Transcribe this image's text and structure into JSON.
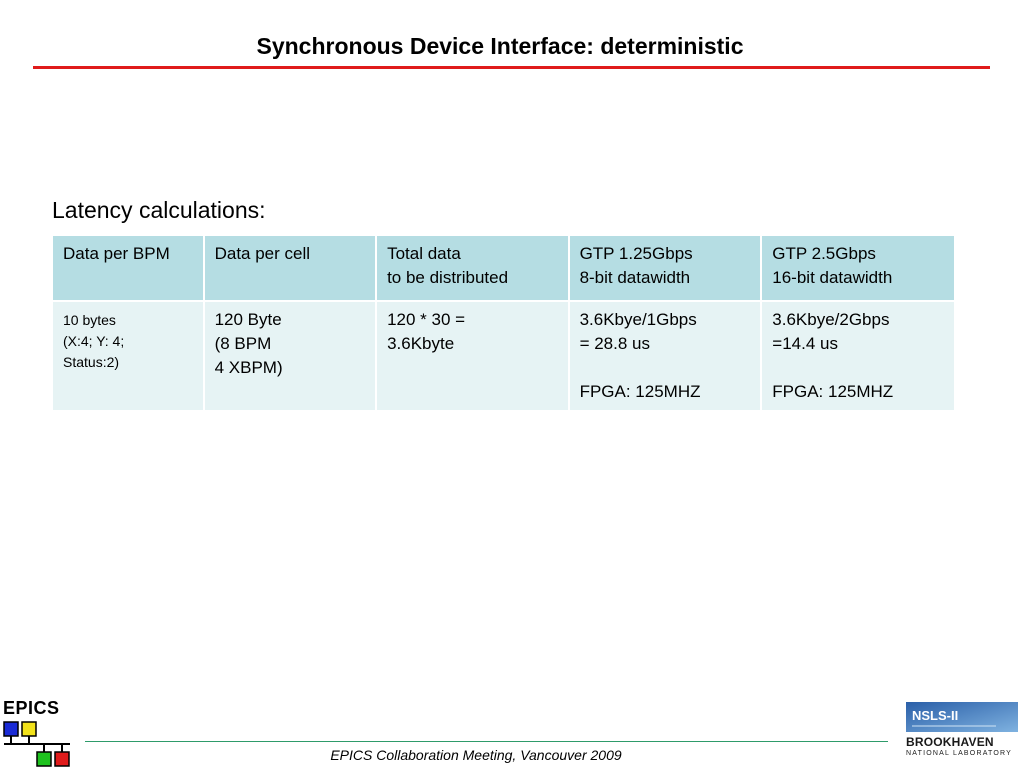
{
  "slide": {
    "title": "Synchronous Device Interface: deterministic",
    "subtitle": "Latency calculations:"
  },
  "table": {
    "headers": [
      "Data per BPM",
      "Data per cell",
      "Total data\nto be distributed",
      "GTP 1.25Gbps\n8-bit datawidth",
      "GTP 2.5Gbps\n16-bit datawidth"
    ],
    "rows": [
      [
        "10 bytes\n(X:4;  Y: 4;\n Status:2)",
        "120 Byte\n(8 BPM\n4 XBPM)",
        "120 * 30 =\n3.6Kbyte",
        "3.6Kbye/1Gbps\n= 28.8 us\n\nFPGA: 125MHZ",
        "3.6Kbye/2Gbps\n=14.4 us\n\nFPGA: 125MHZ"
      ]
    ]
  },
  "footer": {
    "text": "EPICS Collaboration Meeting, Vancouver 2009",
    "left_logo": "EPICS",
    "right_logo_top": "NSLS-II",
    "right_logo_name": "BROOKHAVEN",
    "right_logo_sub": "NATIONAL LABORATORY"
  },
  "colors": {
    "title_rule": "#e01b1b",
    "header_fill": "#b5dde3",
    "body_fill": "#e6f3f4",
    "footer_rule": "#2e9b6a",
    "epics_blue": "#1a2bd6",
    "epics_yellow": "#f2e21a",
    "epics_green": "#1ec21e",
    "epics_red": "#e01b1b"
  },
  "icons": [
    "epics-logo-icon",
    "nsls-ii-logo-icon",
    "brookhaven-logo-icon"
  ]
}
